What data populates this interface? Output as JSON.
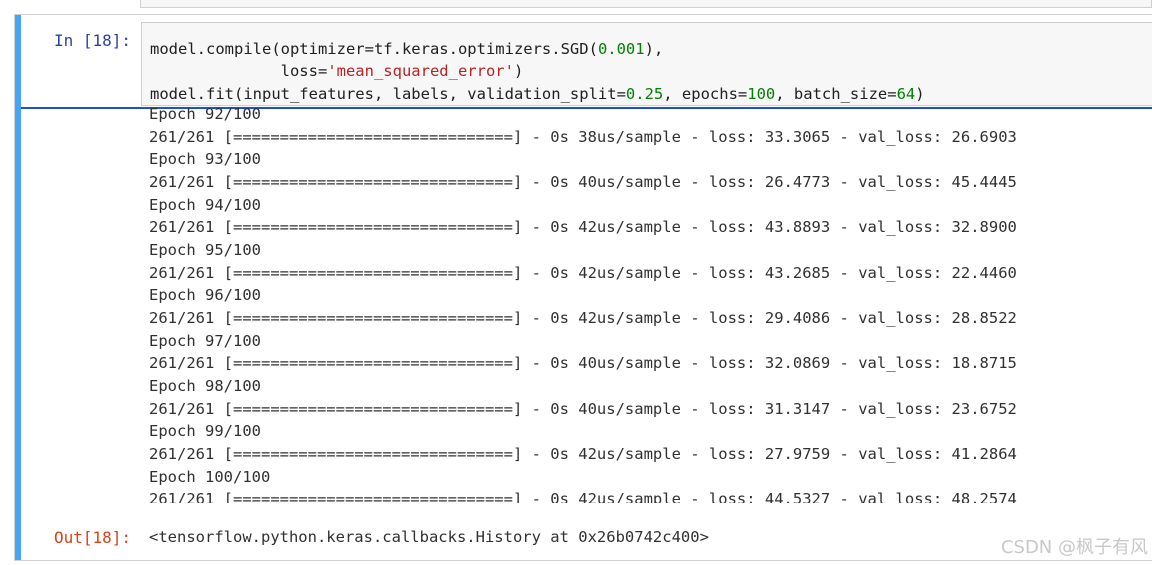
{
  "input_prompt": "In [18]:",
  "output_prompt": "Out[18]:",
  "code": {
    "line1_a": "model.compile(optimizer=tf.keras.optimizers.SGD(",
    "line1_num": "0.001",
    "line1_b": "),",
    "line2_a": "              loss=",
    "line2_str": "'mean_squared_error'",
    "line2_b": ")",
    "line3_a": "model.fit(input_features, labels, validation_split=",
    "line3_n1": "0.25",
    "line3_b": ", epochs=",
    "line3_n2": "100",
    "line3_c": ", batch_size=",
    "line3_n3": "64",
    "line3_d": ")"
  },
  "output_lines": [
    "Epoch 92/100",
    "261/261 [==============================] - 0s 38us/sample - loss: 33.3065 - val_loss: 26.6903",
    "Epoch 93/100",
    "261/261 [==============================] - 0s 40us/sample - loss: 26.4773 - val_loss: 45.4445",
    "Epoch 94/100",
    "261/261 [==============================] - 0s 42us/sample - loss: 43.8893 - val_loss: 32.8900",
    "Epoch 95/100",
    "261/261 [==============================] - 0s 42us/sample - loss: 43.2685 - val_loss: 22.4460",
    "Epoch 96/100",
    "261/261 [==============================] - 0s 42us/sample - loss: 29.4086 - val_loss: 28.8522",
    "Epoch 97/100",
    "261/261 [==============================] - 0s 40us/sample - loss: 32.0869 - val_loss: 18.8715",
    "Epoch 98/100",
    "261/261 [==============================] - 0s 40us/sample - loss: 31.3147 - val_loss: 23.6752",
    "Epoch 99/100",
    "261/261 [==============================] - 0s 42us/sample - loss: 27.9759 - val_loss: 41.2864",
    "Epoch 100/100",
    "261/261 [==============================] - 0s 42us/sample - loss: 44.5327 - val_loss: 48.2574"
  ],
  "result": "<tensorflow.python.keras.callbacks.History at 0x26b0742c400>",
  "watermark": "CSDN @枫子有风",
  "colors": {
    "cell_bar": "#42a5f5",
    "in_prompt": "#303f9f",
    "out_prompt": "#d84315",
    "number": "#008000",
    "string": "#ba2121"
  }
}
